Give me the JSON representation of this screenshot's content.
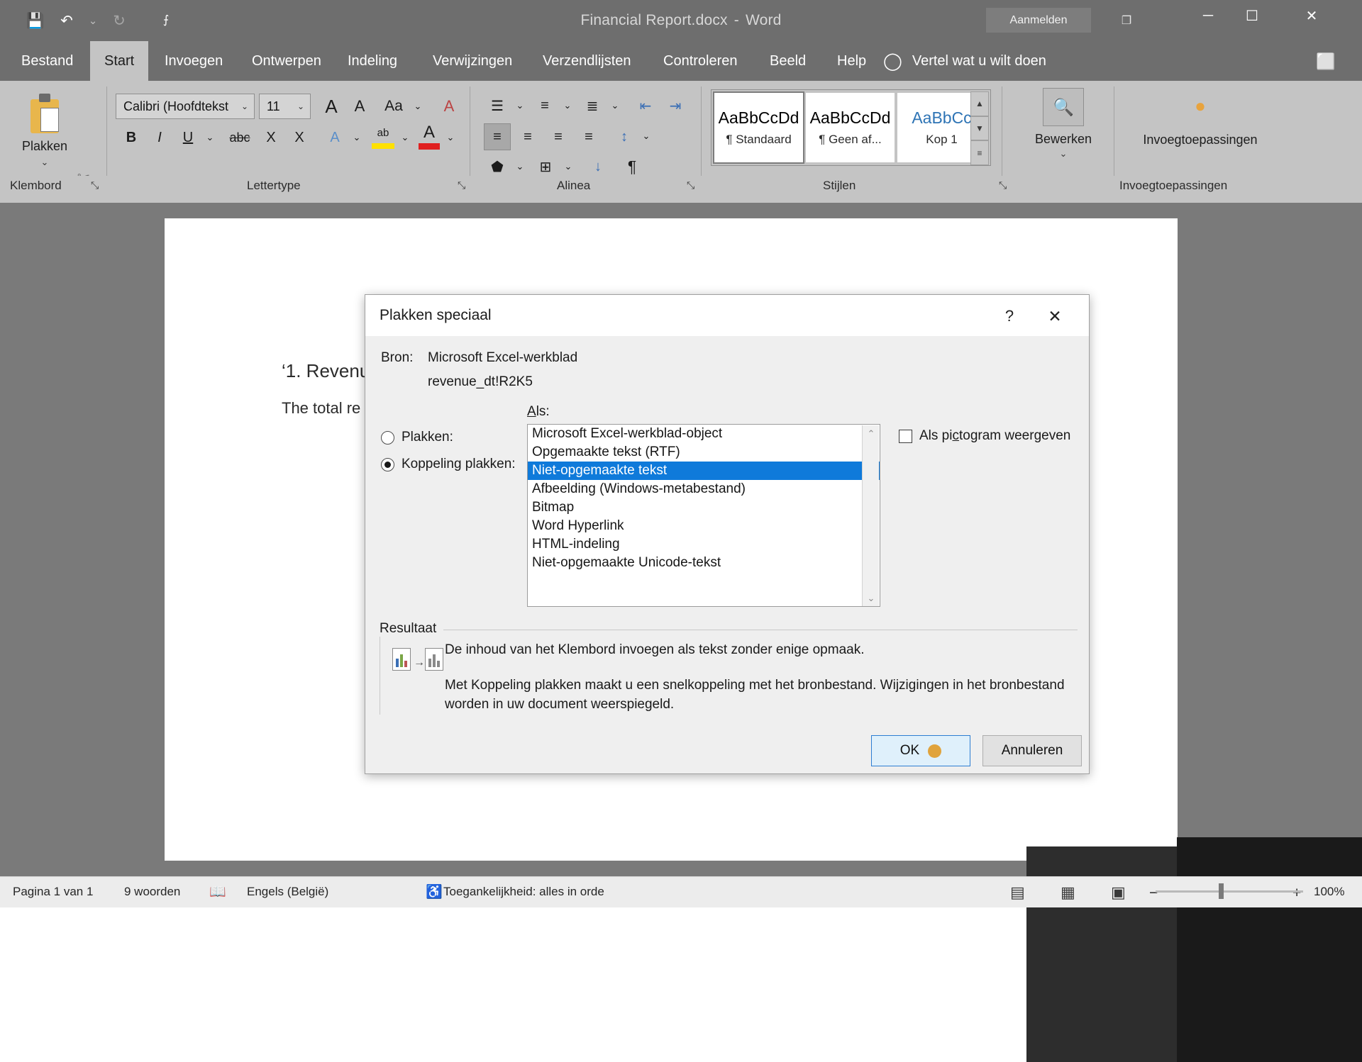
{
  "titlebar": {
    "document_title": "Financial Report.docx",
    "separator": "-",
    "app_name": "Word",
    "signin_label": "Aanmelden",
    "qat": [
      {
        "name": "save-icon",
        "glyph": "💾"
      },
      {
        "name": "undo-icon",
        "glyph": "↶"
      },
      {
        "name": "undo-dropdown-icon",
        "glyph": "⌄"
      },
      {
        "name": "redo-icon",
        "glyph": "↻"
      },
      {
        "name": "customize-qat-icon",
        "glyph": "⨍"
      }
    ],
    "ribbon_display_icon": "❐",
    "minimize": "─",
    "maximize": "☐",
    "close": "✕"
  },
  "tabs": [
    {
      "label": "Bestand",
      "active": false
    },
    {
      "label": "Start",
      "active": true
    },
    {
      "label": "Invoegen",
      "active": false
    },
    {
      "label": "Ontwerpen",
      "active": false
    },
    {
      "label": "Indeling",
      "active": false
    },
    {
      "label": "Verwijzingen",
      "active": false
    },
    {
      "label": "Verzendlijsten",
      "active": false
    },
    {
      "label": "Controleren",
      "active": false
    },
    {
      "label": "Beeld",
      "active": false
    },
    {
      "label": "Help",
      "active": false
    }
  ],
  "tellme": {
    "label": "Vertel wat u wilt doen",
    "bulb_icon": "◯"
  },
  "comments_icon": "⬜",
  "ribbon": {
    "groups": [
      {
        "label": "Klembord",
        "launcher": "⤡"
      },
      {
        "label": "Lettertype",
        "launcher": "⤡"
      },
      {
        "label": "Alinea",
        "launcher": "⤡"
      },
      {
        "label": "Stijlen",
        "launcher": "⤡"
      },
      {
        "label": "Invoegtoepassingen",
        "launcher": ""
      }
    ],
    "clipboard": {
      "paste_label": "Plakken",
      "paste_caret": "⌄",
      "cut_icon": "✂",
      "copy_icon": "⧉",
      "format_painter_icon": "🖌"
    },
    "font": {
      "font_name": "Calibri (Hoofdtekst",
      "font_size": "11",
      "grow_font": "A",
      "shrink_font": "A",
      "change_case": "Aa",
      "clear_format": "A",
      "bold": "B",
      "italic": "I",
      "underline": "U",
      "strikethrough": "abc",
      "subscript": "X",
      "superscript": "X",
      "text_effects": "A",
      "highlight": "ab",
      "font_color": "A",
      "caret": "⌄"
    },
    "paragraph": {
      "bullets": "☰",
      "numbering": "≡",
      "multilevel": "≣",
      "decrease_indent": "⇤",
      "increase_indent": "⇥",
      "align_left": "≡",
      "align_center": "≡",
      "align_right": "≡",
      "justify": "≡",
      "line_spacing": "↕",
      "shading": "⬟",
      "borders": "⊞",
      "sort": "↓",
      "show_marks": "¶"
    },
    "styles": [
      {
        "preview": "AaBbCcDd",
        "name": "¶ Standaard",
        "selected": true,
        "kind": "normal"
      },
      {
        "preview": "AaBbCcDd",
        "name": "¶ Geen af...",
        "selected": false,
        "kind": "normal"
      },
      {
        "preview": "AaBbCc",
        "name": "Kop 1",
        "selected": false,
        "kind": "kop1"
      }
    ],
    "gallery_scroll": {
      "up": "▲",
      "down": "▼",
      "more": "≡"
    },
    "editing": {
      "label": "Bewerken",
      "icon": "🔍",
      "caret": "⌄"
    },
    "addins": {
      "label": "Invoegtoepassingen",
      "icon": "●"
    },
    "collapse_icon": "⌃"
  },
  "document": {
    "heading": "‘1. Revenue",
    "paragraph": "The total re"
  },
  "dialog": {
    "title": "Plakken speciaal",
    "help_icon": "?",
    "close_icon": "✕",
    "source_label": "Bron:",
    "source_value": "Microsoft Excel-werkblad",
    "source_ref": "revenue_dt!R2K5",
    "as_label": "Als:",
    "radio_paste_label": "Plakken:",
    "radio_link_label": "Koppeling plakken:",
    "radio_selected": "link",
    "checkbox_label": "Als pictogram weergeven",
    "checkbox_checked": false,
    "format_list": [
      "Microsoft Excel-werkblad-object",
      "Opgemaakte tekst (RTF)",
      "Niet-opgemaakte tekst",
      "Afbeelding (Windows-metabestand)",
      "Bitmap",
      "Word Hyperlink",
      "HTML-indeling",
      "Niet-opgemaakte Unicode-tekst"
    ],
    "selected_format": "Niet-opgemaakte tekst",
    "scroll_up_icon": "⌃",
    "scroll_down_icon": "⌄",
    "result_legend": "Resultaat",
    "result_text_1": "De inhoud van het Klembord invoegen als tekst zonder enige opmaak.",
    "result_text_2": "Met Koppeling plakken maakt u een snelkoppeling met het bronbestand. Wijzigingen in het bronbestand worden in uw document weerspiegeld.",
    "ok_label": "OK",
    "cancel_label": "Annuleren"
  },
  "statusbar": {
    "page": "Pagina 1 van 1",
    "words": "9 woorden",
    "proofing_icon": "📖",
    "language": "Engels (België)",
    "accessibility_icon": "♿",
    "accessibility": "Toegankelijkheid: alles in orde",
    "view_read_icon": "▤",
    "view_print_icon": "▦",
    "view_web_icon": "▣",
    "zoom_out": "−",
    "zoom_in": "+",
    "zoom_level": "100%"
  }
}
